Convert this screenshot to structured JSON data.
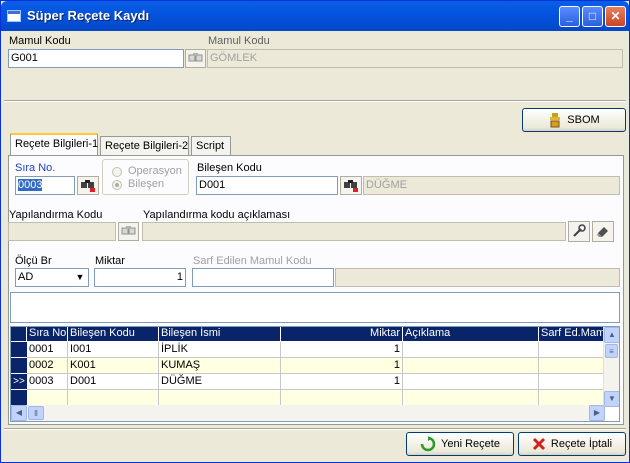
{
  "window": {
    "title": "Süper Reçete Kaydı",
    "minimize": "_",
    "maximize": "□",
    "close": "✕"
  },
  "header": {
    "mamul_kodu_label": "Mamul Kodu",
    "mamul_kodu_value": "G001",
    "mamul_kodu_desc_label": "Mamul Kodu",
    "mamul_kodu_desc_value": "GÖMLEK"
  },
  "sbom_button": "SBOM",
  "tabs": [
    {
      "label": "Reçete Bilgileri-1",
      "active": true
    },
    {
      "label": "Reçete Bilgileri-2",
      "active": false
    },
    {
      "label": "Script",
      "active": false
    }
  ],
  "form": {
    "sira_no_label": "Sıra No.",
    "sira_no_value": "0003",
    "radio_operasyon": "Operasyon",
    "radio_bilesen": "Bileşen",
    "bilesen_kodu_label": "Bileşen Kodu",
    "bilesen_kodu_value": "D001",
    "bilesen_desc_value": "DÜĞME",
    "yapilandirma_kodu_label": "Yapılandırma Kodu",
    "yapilandirma_kodu_value": "",
    "yapilandirma_aciklama_label": "Yapılandırma kodu açıklaması",
    "yapilandirma_aciklama_value": "",
    "olcu_br_label": "Ölçü Br",
    "olcu_br_value": "AD",
    "miktar_label": "Miktar",
    "miktar_value": "1",
    "sarf_label": "Sarf Edilen Mamul Kodu",
    "sarf_value": "",
    "sarf_desc_value": ""
  },
  "grid": {
    "columns": [
      "Sıra No.",
      "Bileşen Kodu",
      "Bileşen İsmi",
      "Miktar",
      "Açıklama",
      "Sarf Ed.Mam."
    ],
    "rows": [
      {
        "indicator": "",
        "sira": "0001",
        "kod": "I001",
        "isim": "İPLİK",
        "miktar": "1",
        "aciklama": "",
        "sarf": ""
      },
      {
        "indicator": "",
        "sira": "0002",
        "kod": "K001",
        "isim": "KUMAŞ",
        "miktar": "1",
        "aciklama": "",
        "sarf": ""
      },
      {
        "indicator": ">>",
        "sira": "0003",
        "kod": "D001",
        "isim": "DÜĞME",
        "miktar": "1",
        "aciklama": "",
        "sarf": ""
      }
    ]
  },
  "footer": {
    "yeni_recete": "Yeni Reçete",
    "recete_iptali": "Reçete İptali"
  },
  "colors": {
    "titlebar": "#0454e0",
    "grid_header": "#0a246a",
    "selected_row": "#ffffe1",
    "label_blue": "#2040c0"
  }
}
